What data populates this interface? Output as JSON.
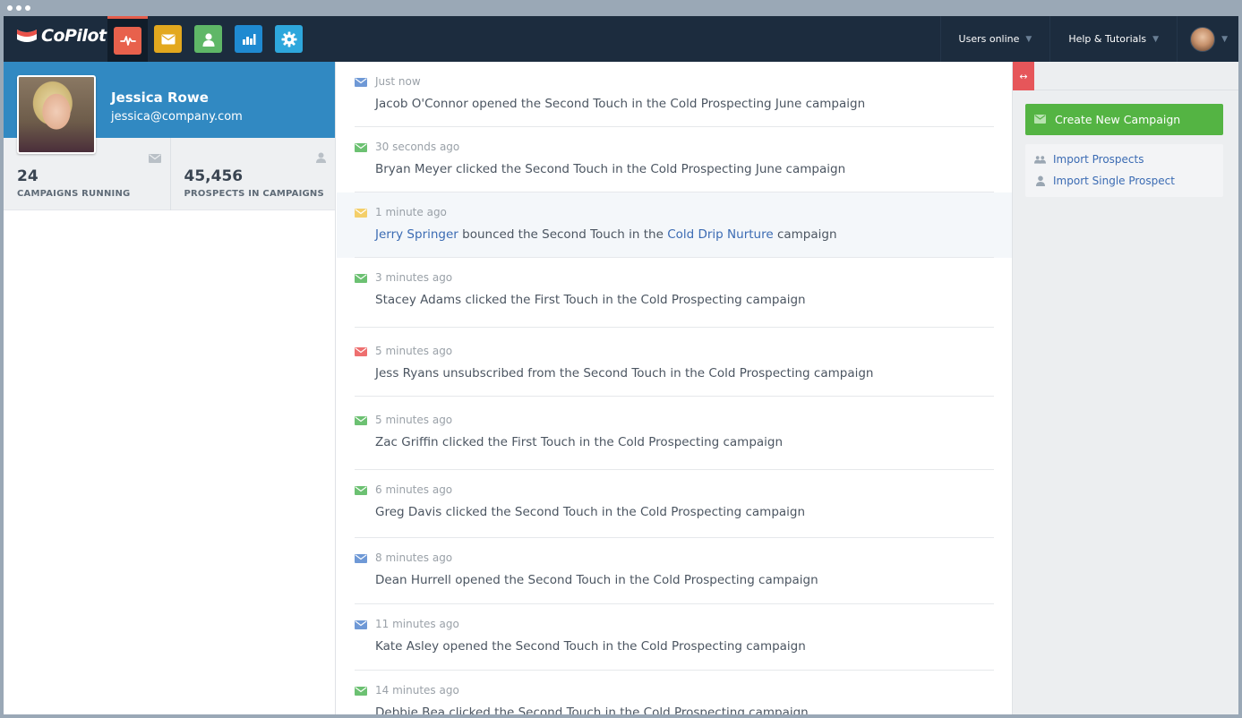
{
  "app": {
    "logo_text": "CoPilot"
  },
  "topbar": {
    "tabs": [
      {
        "name": "activity",
        "icon": "activity-pulse-icon",
        "color": "#e8614c",
        "active": true
      },
      {
        "name": "campaigns",
        "icon": "envelope-icon",
        "color": "#e3a81e",
        "active": false
      },
      {
        "name": "prospects",
        "icon": "user-icon",
        "color": "#5fb767",
        "active": false
      },
      {
        "name": "reports",
        "icon": "bar-chart-icon",
        "color": "#1f8ad1",
        "active": false
      },
      {
        "name": "settings",
        "icon": "gear-icon",
        "color": "#2ea7dc",
        "active": false
      }
    ],
    "users_online_label": "Users online",
    "help_label": "Help & Tutorials"
  },
  "profile": {
    "name": "Jessica Rowe",
    "email": "jessica@company.com"
  },
  "stats": {
    "campaigns_value": "24",
    "campaigns_label": "CAMPAIGNS RUNNING",
    "prospects_value": "45,456",
    "prospects_label": "PROSPECTS IN CAMPAIGNS"
  },
  "feed": [
    {
      "time": "Just now",
      "type": "opened",
      "color": "#6f99d6",
      "parts": [
        {
          "t": "Jacob O'Connor opened the Second Touch in the Cold Prospecting June campaign"
        }
      ]
    },
    {
      "time": "30 seconds ago",
      "type": "clicked",
      "color": "#6cc172",
      "parts": [
        {
          "t": "Bryan Meyer clicked the Second Touch in the Cold Prospecting June campaign"
        }
      ]
    },
    {
      "time": "1 minute ago",
      "type": "bounced",
      "color": "#f4cf6a",
      "parts": [
        {
          "t": "Jerry Springer",
          "link": true
        },
        {
          "t": " bounced the Second Touch in the "
        },
        {
          "t": "Cold Drip Nurture",
          "link": true
        },
        {
          "t": " campaign"
        }
      ]
    },
    {
      "time": "3 minutes ago",
      "type": "clicked",
      "color": "#6cc172",
      "parts": [
        {
          "t": "Stacey Adams clicked the First Touch in the Cold Prospecting campaign"
        }
      ]
    },
    {
      "time": "5 minutes ago",
      "type": "unsubscribed",
      "color": "#ee6f6f",
      "parts": [
        {
          "t": "Jess Ryans unsubscribed from the Second Touch in the Cold Prospecting campaign"
        }
      ]
    },
    {
      "time": "5 minutes ago",
      "type": "clicked",
      "color": "#6cc172",
      "parts": [
        {
          "t": "Zac Griffin clicked the First Touch in the Cold Prospecting campaign"
        }
      ]
    },
    {
      "time": "6 minutes ago",
      "type": "clicked",
      "color": "#6cc172",
      "parts": [
        {
          "t": "Greg Davis clicked the Second Touch in the Cold Prospecting campaign"
        }
      ]
    },
    {
      "time": "8 minutes ago",
      "type": "opened",
      "color": "#6f99d6",
      "parts": [
        {
          "t": "Dean Hurrell opened the Second Touch in the Cold Prospecting campaign"
        }
      ]
    },
    {
      "time": "11 minutes ago",
      "type": "opened",
      "color": "#6f99d6",
      "parts": [
        {
          "t": "Kate Asley opened the Second Touch in the Cold Prospecting campaign"
        }
      ]
    },
    {
      "time": "14 minutes ago",
      "type": "clicked",
      "color": "#6cc172",
      "parts": [
        {
          "t": "Debbie Bea clicked the Second Touch in the Cold Prospecting campaign"
        }
      ]
    }
  ],
  "sidebar_right": {
    "create_label": "Create New Campaign",
    "import_prospects_label": "Import Prospects",
    "import_single_label": "Import Single Prospect"
  },
  "colors": {
    "nav_bg": "#1c2c3e",
    "profile_bg": "#3189c2",
    "create_button": "#54b443",
    "toggle_red": "#e6565a",
    "link": "#3b6bb3"
  }
}
